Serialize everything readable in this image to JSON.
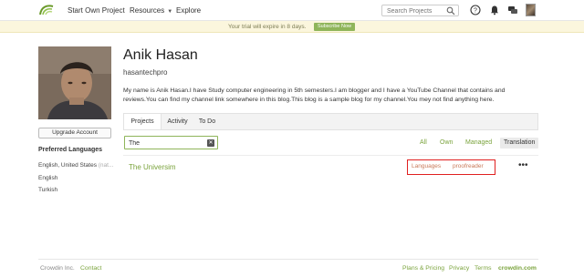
{
  "header": {
    "nav": {
      "start_project": "Start Own Project",
      "resources": "Resources",
      "explore": "Explore"
    },
    "search": {
      "placeholder": "Search Projects",
      "value": ""
    },
    "icons": [
      "crowdin-logo-icon",
      "search-icon",
      "help-icon",
      "notifications-bell-icon",
      "messages-icon",
      "user-avatar"
    ]
  },
  "banner": {
    "text": "Your trial will expire in 8 days.",
    "subscribe_label": "Subscribe Now"
  },
  "sidebar": {
    "upgrade_label": "Upgrade Account",
    "preferred_languages_title": "Preferred Languages",
    "languages": [
      {
        "name": "English, United States",
        "suffix": "(nat..."
      },
      {
        "name": "English",
        "suffix": ""
      },
      {
        "name": "Turkish",
        "suffix": ""
      }
    ]
  },
  "profile": {
    "name": "Anik Hasan",
    "username": "hasantechpro",
    "bio": "My name is Anik Hasan.I have Study computer engineering in 5th semesters.I am blogger and I have a YouTube Channel that contains and reviews.You can find my channel link somewhere in this blog.This blog is a sample blog for my channel.You mey not find anything here."
  },
  "tabs": {
    "projects": "Projects",
    "activity": "Activity",
    "todo": "To Do",
    "active": "projects"
  },
  "filter": {
    "value": "The",
    "clear_icon": "clear-icon",
    "options": {
      "all": "All",
      "own": "Own",
      "managed": "Managed",
      "translation": "Translation"
    },
    "selected": "translation"
  },
  "projects": [
    {
      "name": "The Universim",
      "languages_label": "Languages",
      "role": "proofreader",
      "more": "•••"
    }
  ],
  "footer": {
    "company": "Crowdin Inc.",
    "contact": "Contact",
    "plans": "Plans & Pricing",
    "privacy": "Privacy",
    "terms": "Terms",
    "domain": "crowdin.com"
  },
  "colors": {
    "accent_green": "#7aa33c",
    "banner_bg": "#fbf6dd",
    "highlight_red": "#e02020"
  }
}
